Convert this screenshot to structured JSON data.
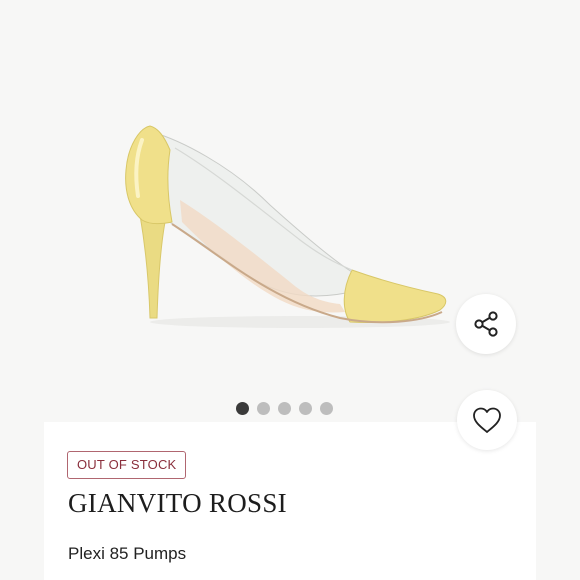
{
  "product": {
    "status_badge": "OUT OF STOCK",
    "brand": "GIANVITO ROSSI",
    "name": "Plexi 85 Pumps"
  },
  "gallery": {
    "image_count": 5,
    "active_index": 0
  },
  "actions": {
    "share_icon": "share-icon",
    "like_icon": "heart-icon"
  },
  "colors": {
    "badge_text": "#8a2f3c",
    "badge_border": "#b06670",
    "dot_active": "#3a3a3a",
    "dot_inactive": "#bdbdbd",
    "shoe_leather": "#f0e08a"
  }
}
